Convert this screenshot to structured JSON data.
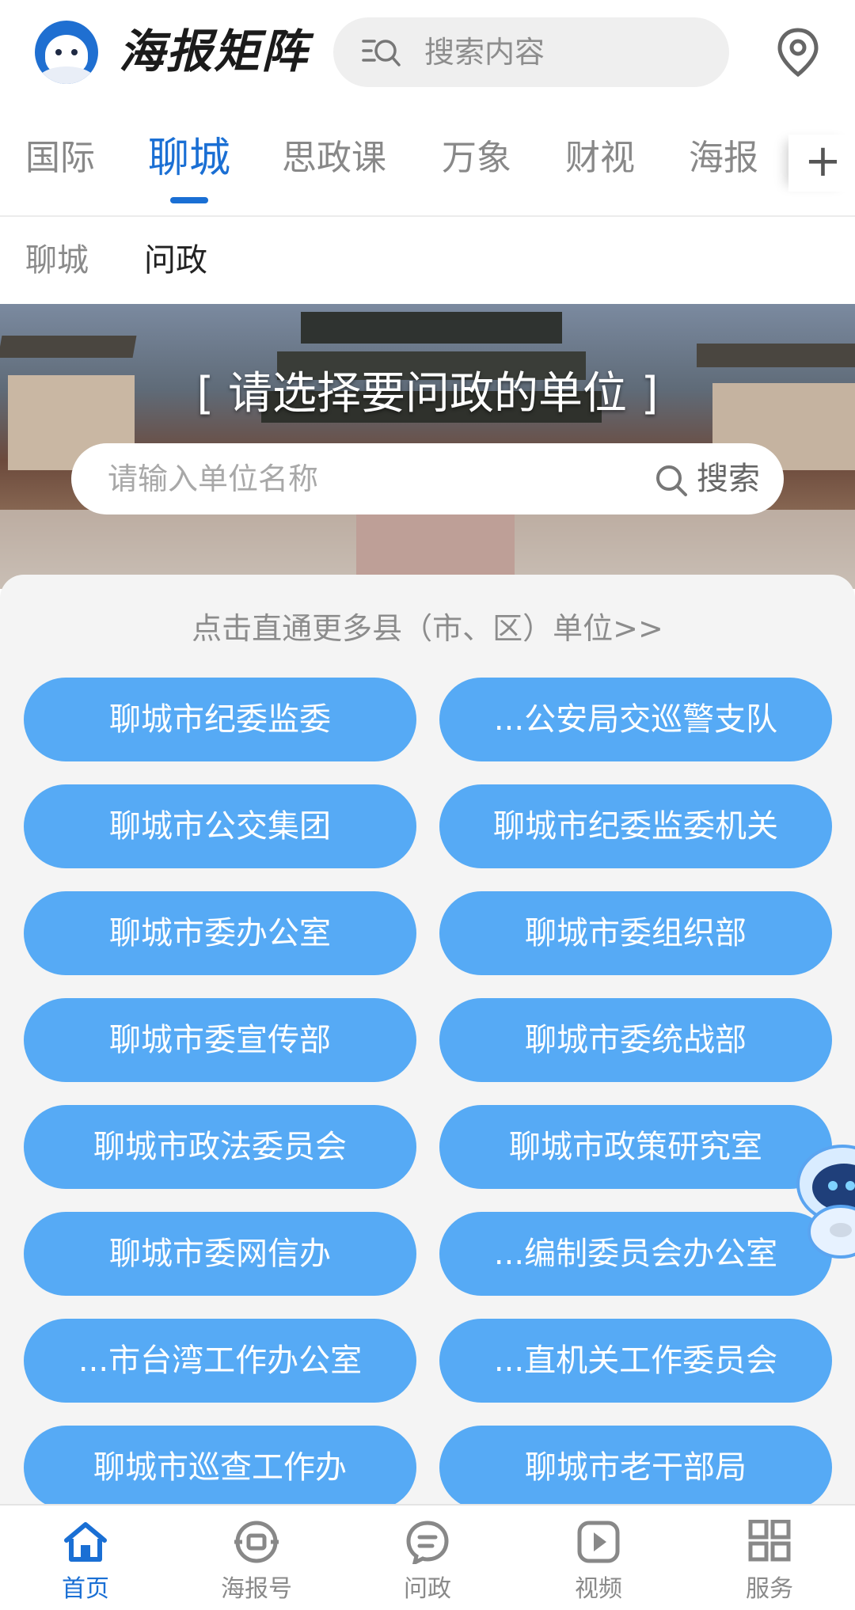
{
  "header": {
    "brand": "海报矩阵",
    "search_placeholder": "搜索内容",
    "logo_icon": "seal-logo-icon",
    "location_icon": "location-pin-icon"
  },
  "tabs": [
    {
      "label": "国际"
    },
    {
      "label": "聊城"
    },
    {
      "label": "思政课"
    },
    {
      "label": "万象"
    },
    {
      "label": "财视"
    },
    {
      "label": "海报"
    }
  ],
  "tabs_active": "聊城",
  "tabs_more": "+",
  "subtabs": [
    {
      "label": "聊城"
    },
    {
      "label": "问政"
    }
  ],
  "banner": {
    "title": "[ 请选择要问政的单位 ]",
    "search_placeholder": "请输入单位名称",
    "search_button": "搜索"
  },
  "panel": {
    "more_link": "点击直通更多县（市、区）单位>>",
    "units": [
      {
        "label": "聊城市纪委监委"
      },
      {
        "label": "...公安局交巡警支队"
      },
      {
        "label": "聊城市公交集团"
      },
      {
        "label": "聊城市纪委监委机关"
      },
      {
        "label": "聊城市委办公室"
      },
      {
        "label": "聊城市委组织部"
      },
      {
        "label": "聊城市委宣传部"
      },
      {
        "label": "聊城市委统战部"
      },
      {
        "label": "聊城市政法委员会"
      },
      {
        "label": "聊城市政策研究室"
      },
      {
        "label": "聊城市委网信办"
      },
      {
        "label": "...编制委员会办公室"
      },
      {
        "label": "...市台湾工作办公室"
      },
      {
        "label": "...直机关工作委员会"
      },
      {
        "label": "聊城市巡查工作办"
      },
      {
        "label": "聊城市老干部局"
      }
    ]
  },
  "bottom_nav": [
    {
      "label": "首页",
      "icon": "home-icon"
    },
    {
      "label": "海报号",
      "icon": "poster-account-icon"
    },
    {
      "label": "问政",
      "icon": "chat-question-icon"
    },
    {
      "label": "视频",
      "icon": "play-video-icon"
    },
    {
      "label": "服务",
      "icon": "grid-services-icon"
    }
  ],
  "colors": {
    "accent": "#1a6fd4",
    "unit_button": "#56aaf5",
    "panel_bg": "#f4f4f4"
  }
}
